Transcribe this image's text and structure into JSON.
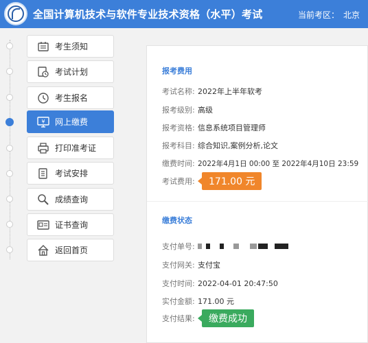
{
  "header": {
    "title": "全国计算机技术与软件专业技术资格（水平）考试",
    "region_label": "当前考区：",
    "region_value": "北京",
    "brand_color": "#3c7fd9"
  },
  "sidebar": {
    "items": [
      {
        "label": "考生须知",
        "icon": "notice-icon",
        "active": false
      },
      {
        "label": "考试计划",
        "icon": "calendar-clock-icon",
        "active": false
      },
      {
        "label": "考生报名",
        "icon": "clock-icon",
        "active": false
      },
      {
        "label": "网上缴费",
        "icon": "yen-monitor-icon",
        "active": true
      },
      {
        "label": "打印准考证",
        "icon": "printer-icon",
        "active": false
      },
      {
        "label": "考试安排",
        "icon": "document-icon",
        "active": false
      },
      {
        "label": "成绩查询",
        "icon": "magnifier-icon",
        "active": false
      },
      {
        "label": "证书查询",
        "icon": "certificate-icon",
        "active": false
      },
      {
        "label": "返回首页",
        "icon": "home-icon",
        "active": false
      }
    ]
  },
  "fee": {
    "section_title": "报考费用",
    "rows": [
      {
        "label": "考试名称:",
        "value": "2022年上半年软考"
      },
      {
        "label": "报考级别:",
        "value": "高级"
      },
      {
        "label": "报考资格:",
        "value": "信息系统项目管理师"
      },
      {
        "label": "报考科目:",
        "value": "综合知识,案例分析,论文"
      },
      {
        "label": "缴费时间:",
        "value": "2022年4月1日 00:00 至 2022年4月10日 23:59"
      }
    ],
    "amount_label": "考试费用:",
    "amount_value": "171.00 元",
    "amount_color": "#f0862b"
  },
  "status": {
    "section_title": "缴费状态",
    "order_label": "支付单号:",
    "gateway_label": "支付网关:",
    "gateway_value": "支付宝",
    "time_label": "支付时间:",
    "time_value": "2022-04-01 20:47:50",
    "paid_label": "实付金额:",
    "paid_value": "171.00 元",
    "result_label": "支付结果:",
    "result_value": "缴费成功",
    "result_color": "#3aaa5e"
  }
}
